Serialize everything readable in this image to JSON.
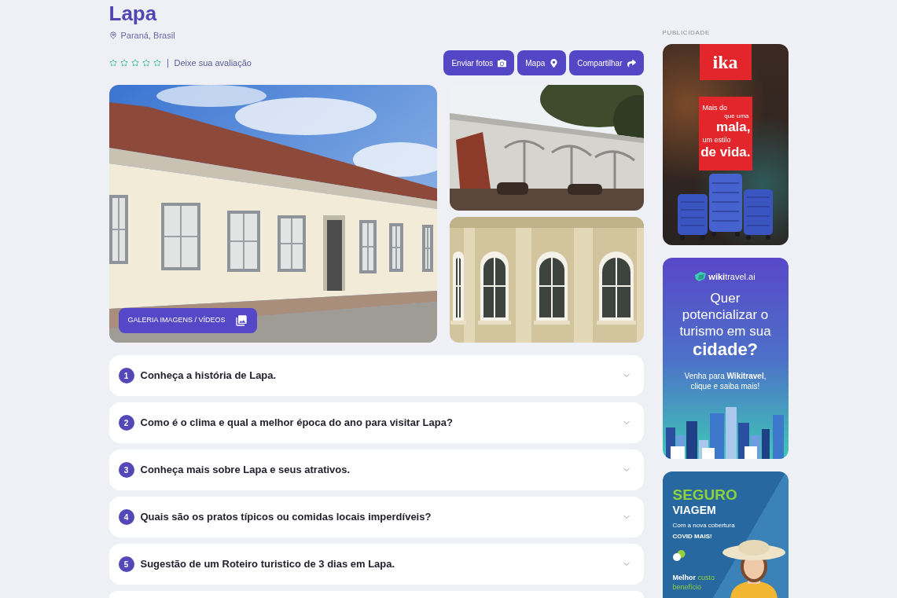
{
  "place": {
    "title": "Lapa",
    "location": "Paraná, Brasil"
  },
  "rating": {
    "stars": 0,
    "link": "Deixe sua avaliação"
  },
  "actions": [
    {
      "kind": "upload",
      "label": "Enviar fotos"
    },
    {
      "kind": "map",
      "label": "Mapa"
    },
    {
      "kind": "share",
      "label": "Compartilhar"
    }
  ],
  "gallery": {
    "button": "GALERIA IMAGENS / VÍDEOS"
  },
  "faq": [
    {
      "number": "1",
      "title": "Conheça a história de Lapa.",
      "expanded": false
    },
    {
      "number": "2",
      "title": "Como é o clima e qual a melhor época do ano para visitar Lapa?",
      "expanded": false
    },
    {
      "number": "3",
      "title": "Conheça mais sobre Lapa e seus atrativos.",
      "expanded": false
    },
    {
      "number": "4",
      "title": "Quais são os pratos típicos ou comidas locais imperdíveis?",
      "expanded": false
    },
    {
      "number": "5",
      "title": "Sugestão de um Roteiro turistico de 3 dias em Lapa.",
      "expanded": false
    }
  ],
  "sidebar": {
    "label": "PUBLICIDADE",
    "ads": [
      {
        "kind": "luggage",
        "logo": "ika",
        "tagline": [
          {
            "kind": "plain",
            "text": "Mais do"
          },
          {
            "kind": "aside",
            "text": "que uma"
          },
          {
            "kind": "strong",
            "text": "mala,"
          },
          {
            "kind": "plain",
            "text": "um estilo"
          },
          {
            "kind": "strong",
            "text": "de vida."
          }
        ]
      },
      {
        "kind": "tourism",
        "logo": "**wiki**travel.ai",
        "headline": "Quer potencializar o turismo em sua",
        "headline_emphasis": "cidade?",
        "body": "Venha para **Wikitravel**, clique e saiba mais!"
      },
      {
        "kind": "insurance",
        "title": "SEGURO",
        "subtitle": "VIAGEM",
        "note": "Com a nova cobertura",
        "note_emphasis": "COVID MAIS!",
        "tagline_lead": "Melhor",
        "tagline": "custo benefício"
      }
    ]
  }
}
